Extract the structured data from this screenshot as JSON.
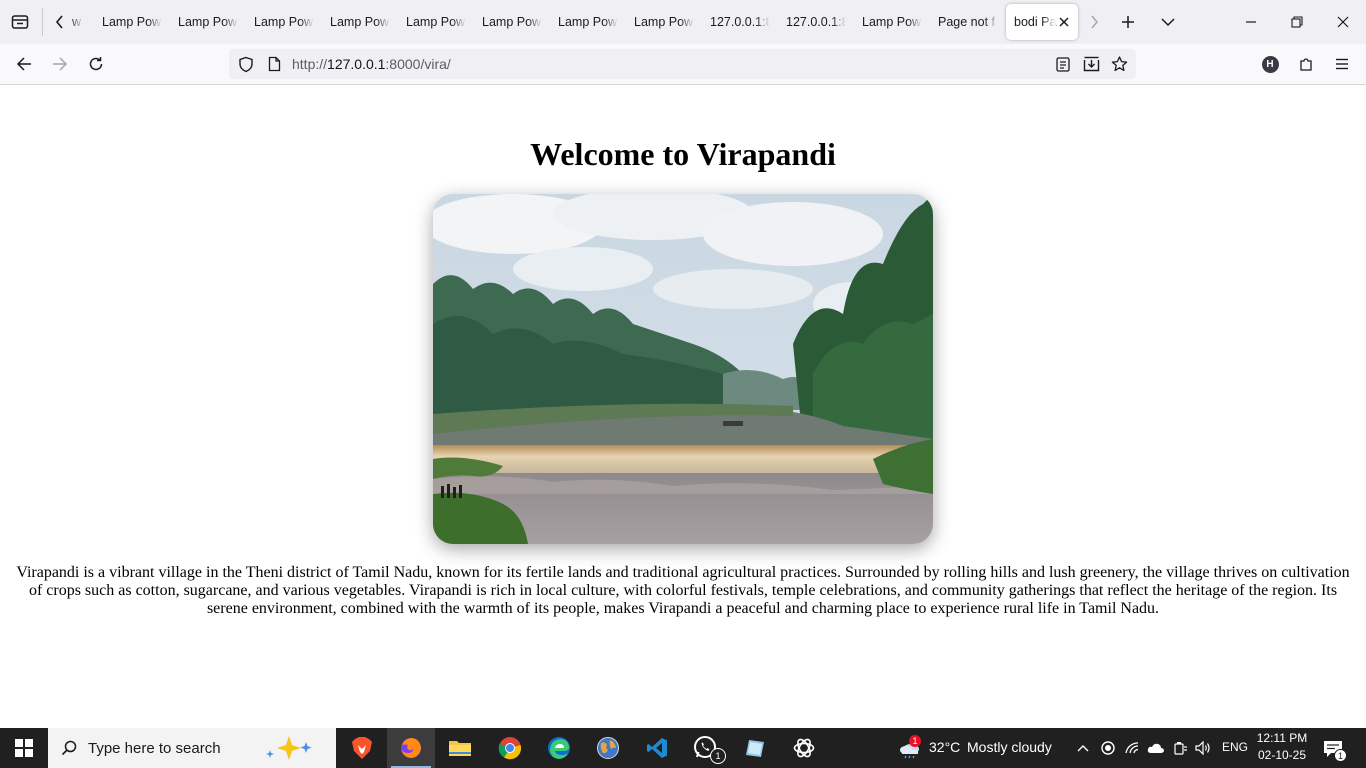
{
  "browser": {
    "tabs": [
      {
        "label": "w",
        "partial": true
      },
      {
        "label": "Lamp Pow"
      },
      {
        "label": "Lamp Pow"
      },
      {
        "label": "Lamp Pow"
      },
      {
        "label": "Lamp Pow"
      },
      {
        "label": "Lamp Pow"
      },
      {
        "label": "Lamp Pow"
      },
      {
        "label": "Lamp Pow"
      },
      {
        "label": "Lamp Pow"
      },
      {
        "label": "127.0.0.1:8"
      },
      {
        "label": "127.0.0.1:8"
      },
      {
        "label": "Lamp Pow"
      },
      {
        "label": "Page not f"
      },
      {
        "label": "bodi Pa",
        "active": true
      }
    ],
    "url_prefix": "http://",
    "url_host": "127.0.0.1",
    "url_rest": ":8000/vira/",
    "profile_initial": "H"
  },
  "page": {
    "heading": "Welcome to Virapandi",
    "image_alt": "Virapandi river and check dam",
    "description": "Virapandi is a vibrant village in the Theni district of Tamil Nadu, known for its fertile lands and traditional agricultural practices. Surrounded by rolling hills and lush greenery, the village thrives on cultivation of crops such as cotton, sugarcane, and various vegetables. Virapandi is rich in local culture, with colorful festivals, temple celebrations, and community gatherings that reflect the heritage of the region. Its serene environment, combined with the warmth of its people, makes Virapandi a peaceful and charming place to experience rural life in Tamil Nadu."
  },
  "taskbar": {
    "search_placeholder": "Type here to search",
    "weather_temp": "32°C",
    "weather_text": "Mostly cloudy",
    "weather_badge": "1",
    "whatsapp_badge": "1",
    "language": "ENG",
    "time": "12:11 PM",
    "date": "02-10-25",
    "notification_count": "1"
  }
}
